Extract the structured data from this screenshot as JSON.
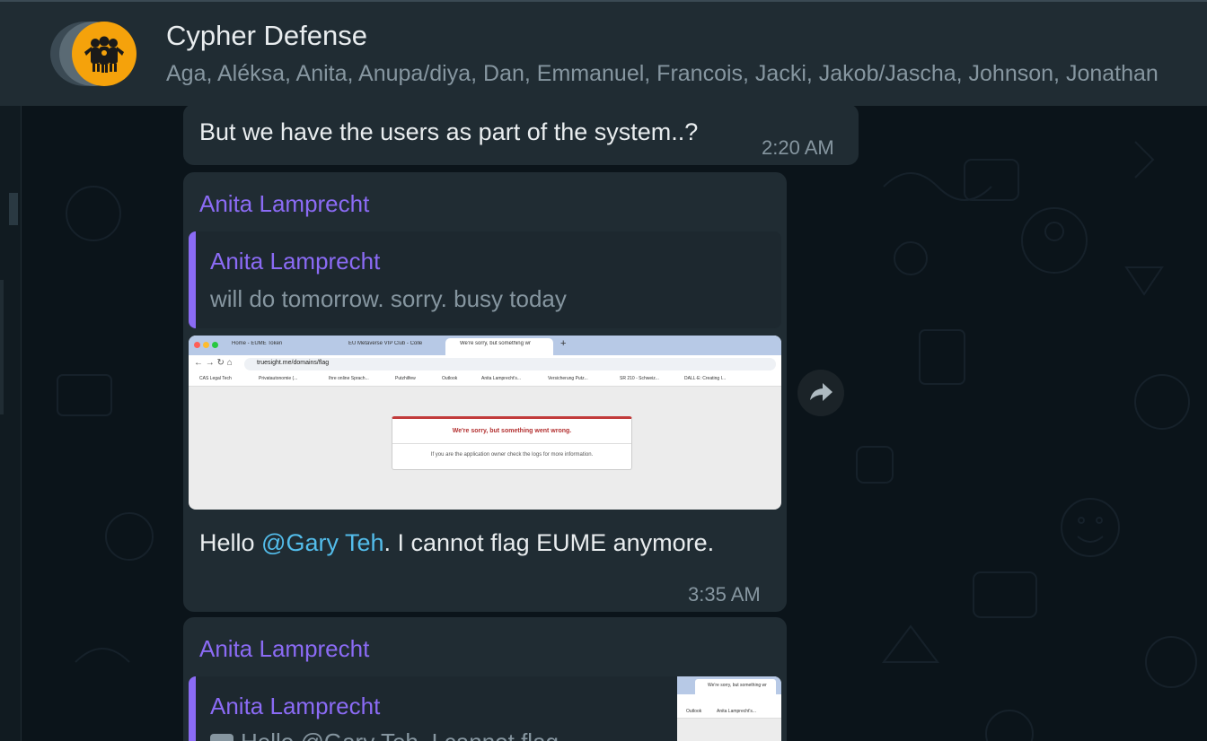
{
  "chat": {
    "title": "Cypher Defense",
    "members": "Aga, Aléksa, Anita, Anupa/diya, Dan, Emmanuel, Francois, Jacki, Jakob/Jascha, Johnson, Jonathan"
  },
  "messages": [
    {
      "text": "But we have the users as part of the system..?",
      "time": "2:20 AM"
    },
    {
      "sender": "Anita Lamprecht",
      "quote": {
        "sender": "Anita Lamprecht",
        "text": "will do tomorrow. sorry. busy today"
      },
      "screenshot": {
        "tabs": [
          "Home - EUME Token",
          "EU Metaverse VIP Club - Colle",
          "We're sorry, but something wr"
        ],
        "url": "truesight.me/domains/flag",
        "bookmarks": [
          "CAS Legal Tech",
          "Privatautonomie (...",
          "Ihre online Sprach...",
          "Putzhilfew",
          "Outlook",
          "Anita Lamprecht's...",
          "Versicherung Putz...",
          "SR 210 - Schweiz...",
          "DALL·E: Creating I..."
        ],
        "error_title": "We're sorry, but something went wrong.",
        "error_body": "If you are the application owner check the logs for more information."
      },
      "text_before": "Hello ",
      "mention": "@Gary Teh",
      "text_after": ". I cannot flag  EUME anymore.",
      "time": "3:35 AM"
    },
    {
      "sender": "Anita Lamprecht",
      "quote": {
        "sender": "Anita Lamprecht",
        "text": "Hello @Gary Teh. I cannot flag",
        "thumb_tab": "We're sorry, but something wr",
        "thumb_bookmarks": [
          "Outlook",
          "Anita Lamprecht's..."
        ]
      }
    }
  ],
  "colors": {
    "background": "#0b141a",
    "bubble": "#202c33",
    "sender": "#8b6bf5",
    "mention": "#53bdeb",
    "text": "#e9edef",
    "secondary": "#8696a0",
    "avatar": "#f5a20b"
  }
}
